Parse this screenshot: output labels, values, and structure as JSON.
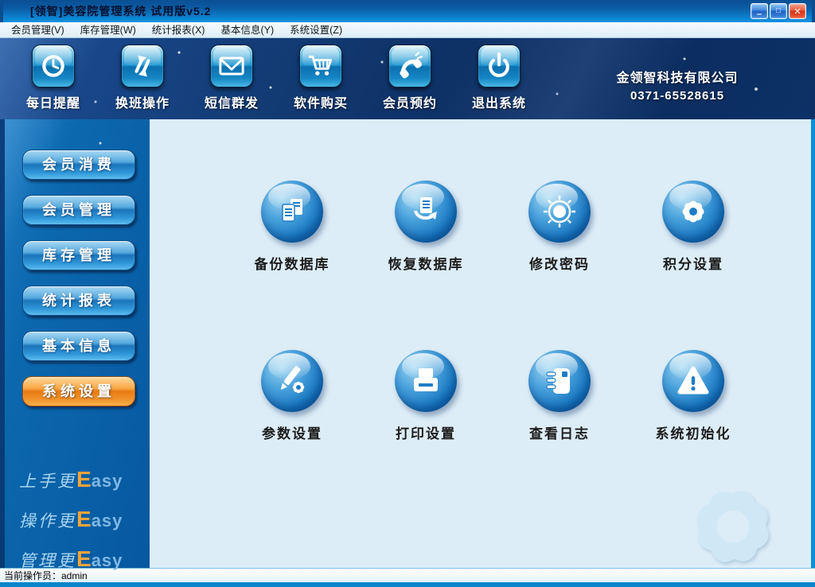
{
  "window": {
    "title": "[领智]美容院管理系统  试用版v5.2",
    "controls": {
      "minimize": "–",
      "maximize": "□",
      "close": "✕"
    }
  },
  "menubar": {
    "items": [
      {
        "label": "会员管理(V)"
      },
      {
        "label": "库存管理(W)"
      },
      {
        "label": "统计报表(X)"
      },
      {
        "label": "基本信息(Y)"
      },
      {
        "label": "系统设置(Z)"
      }
    ]
  },
  "toolbar": {
    "buttons": [
      {
        "label": "每日提醒",
        "icon": "clock-icon"
      },
      {
        "label": "换班操作",
        "icon": "swap-arrows-icon"
      },
      {
        "label": "短信群发",
        "icon": "envelope-icon"
      },
      {
        "label": "软件购买",
        "icon": "shopping-cart-icon"
      },
      {
        "label": "会员预约",
        "icon": "phone-icon"
      },
      {
        "label": "退出系统",
        "icon": "power-icon"
      }
    ],
    "company": {
      "name": "金领智科技有限公司",
      "phone": "0371-65528615"
    }
  },
  "sidebar": {
    "items": [
      {
        "label": "会员消费",
        "active": false
      },
      {
        "label": "会员管理",
        "active": false
      },
      {
        "label": "库存管理",
        "active": false
      },
      {
        "label": "统计报表",
        "active": false
      },
      {
        "label": "基本信息",
        "active": false
      },
      {
        "label": "系统设置",
        "active": true
      }
    ],
    "slogans": [
      {
        "prefix": "上手更",
        "em": "E",
        "rest": "asy"
      },
      {
        "prefix": "操作更",
        "em": "E",
        "rest": "asy"
      },
      {
        "prefix": "管理更",
        "em": "E",
        "rest": "asy"
      }
    ]
  },
  "main": {
    "icons": [
      {
        "label": "备份数据库",
        "icon": "backup-database-icon"
      },
      {
        "label": "恢复数据库",
        "icon": "restore-database-icon"
      },
      {
        "label": "修改密码",
        "icon": "change-password-icon"
      },
      {
        "label": "积分设置",
        "icon": "points-settings-icon"
      },
      {
        "label": "参数设置",
        "icon": "parameter-settings-icon"
      },
      {
        "label": "打印设置",
        "icon": "print-settings-icon"
      },
      {
        "label": "查看日志",
        "icon": "view-log-icon"
      },
      {
        "label": "系统初始化",
        "icon": "system-init-icon"
      }
    ]
  },
  "statusbar": {
    "text": "当前操作员：admin"
  },
  "colors": {
    "titlebar_top": "#0a4f93",
    "titlebar_bottom": "#0f94e4",
    "band_navy": "#0b2a5c",
    "sidebar_blue": "#0c68ae",
    "active_orange": "#e87a12",
    "content_bg": "#dcedf7",
    "sphere_blue": "#1575bf",
    "frame_right": "#0a8fd8",
    "close_red": "#d63317"
  }
}
